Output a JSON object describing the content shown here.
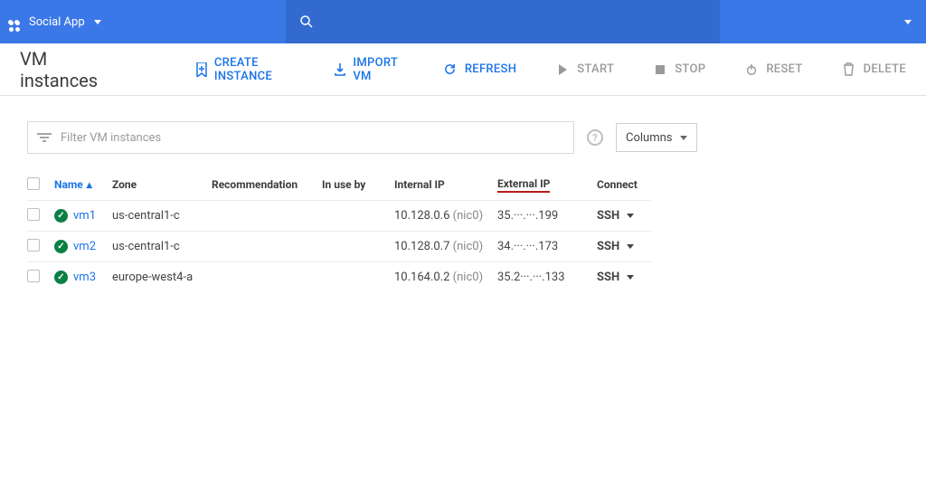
{
  "topbar": {
    "project_name": "Social App"
  },
  "page": {
    "title": "VM instances"
  },
  "actions": {
    "create": "CREATE INSTANCE",
    "import": "IMPORT VM",
    "refresh": "REFRESH",
    "start": "START",
    "stop": "STOP",
    "reset": "RESET",
    "delete": "DELETE"
  },
  "filter": {
    "placeholder": "Filter VM instances",
    "columns_label": "Columns"
  },
  "columns": {
    "name": "Name",
    "zone": "Zone",
    "recommendation": "Recommendation",
    "in_use_by": "In use by",
    "internal_ip": "Internal IP",
    "external_ip": "External IP",
    "connect": "Connect"
  },
  "rows": [
    {
      "name": "vm1",
      "zone": "us-central1-c",
      "internal_ip": "10.128.0.6",
      "internal_nic": "(nic0)",
      "external_ip": "35.···.···.199",
      "connect": "SSH"
    },
    {
      "name": "vm2",
      "zone": "us-central1-c",
      "internal_ip": "10.128.0.7",
      "internal_nic": "(nic0)",
      "external_ip": "34.···.···.173",
      "connect": "SSH"
    },
    {
      "name": "vm3",
      "zone": "europe-west4-a",
      "internal_ip": "10.164.0.2",
      "internal_nic": "(nic0)",
      "external_ip": "35.2···.···.133",
      "connect": "SSH"
    }
  ]
}
